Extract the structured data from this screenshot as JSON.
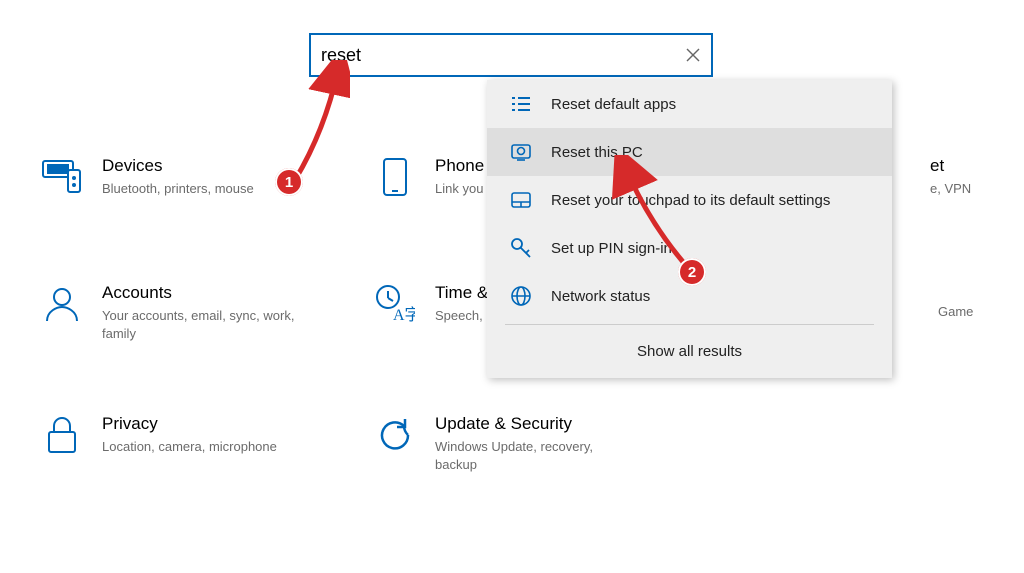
{
  "search": {
    "value": "reset"
  },
  "tiles": {
    "devices": {
      "title": "Devices",
      "sub": "Bluetooth, printers, mouse"
    },
    "phone": {
      "title": "Phone",
      "sub": "Link you"
    },
    "net": {
      "title_frag": "et",
      "sub_frag": "e, VPN"
    },
    "accounts": {
      "title": "Accounts",
      "sub": "Your accounts, email, sync, work, family"
    },
    "time": {
      "title": "Time &",
      "sub": "Speech,"
    },
    "gaming": {
      "sub_frag": "Game"
    },
    "privacy": {
      "title": "Privacy",
      "sub": "Location, camera, microphone"
    },
    "update": {
      "title": "Update & Security",
      "sub": "Windows Update, recovery, backup"
    }
  },
  "results": {
    "items": [
      "Reset default apps",
      "Reset this PC",
      "Reset your touchpad to its default settings",
      "Set up PIN sign-in",
      "Network status"
    ],
    "show_all": "Show all results"
  },
  "markers": {
    "one": "1",
    "two": "2"
  }
}
